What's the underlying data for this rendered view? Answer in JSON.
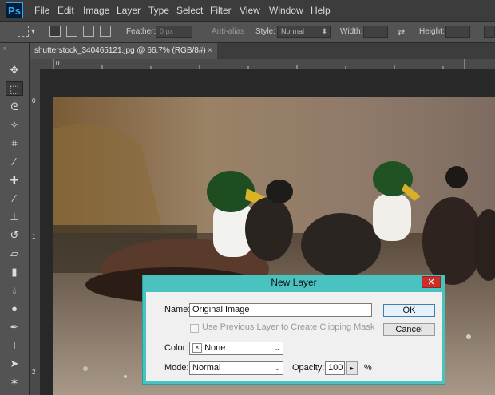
{
  "app": {
    "logo": "Ps"
  },
  "menu": [
    "File",
    "Edit",
    "Image",
    "Layer",
    "Type",
    "Select",
    "Filter",
    "View",
    "Window",
    "Help"
  ],
  "options_bar": {
    "feather_label": "Feather:",
    "feather_value": "0 px",
    "antialias_label": "Anti-alias",
    "style_label": "Style:",
    "style_value": "Normal",
    "width_label": "Width:",
    "height_label": "Height:"
  },
  "tab": {
    "title": "shutterstock_340465121.jpg @ 66.7% (RGB/8#)",
    "close": "×"
  },
  "ruler": {
    "left_marks": [
      "0",
      "1",
      "2"
    ],
    "top_marks": [
      "0"
    ]
  },
  "dialog": {
    "title": "New Layer",
    "close": "✕",
    "name_label": "Name:",
    "name_value": "Original Image",
    "clip_label": "Use Previous Layer to Create Clipping Mask",
    "color_label": "Color:",
    "color_value": "None",
    "color_swatch": "×",
    "mode_label": "Mode:",
    "mode_value": "Normal",
    "opacity_label": "Opacity:",
    "opacity_value": "100",
    "opacity_unit": "%",
    "ok_label": "OK",
    "cancel_label": "Cancel"
  },
  "colors": {
    "dialog_frame": "#49c2c0",
    "close_red": "#c9302c",
    "ps_blue": "#31a8ff"
  }
}
